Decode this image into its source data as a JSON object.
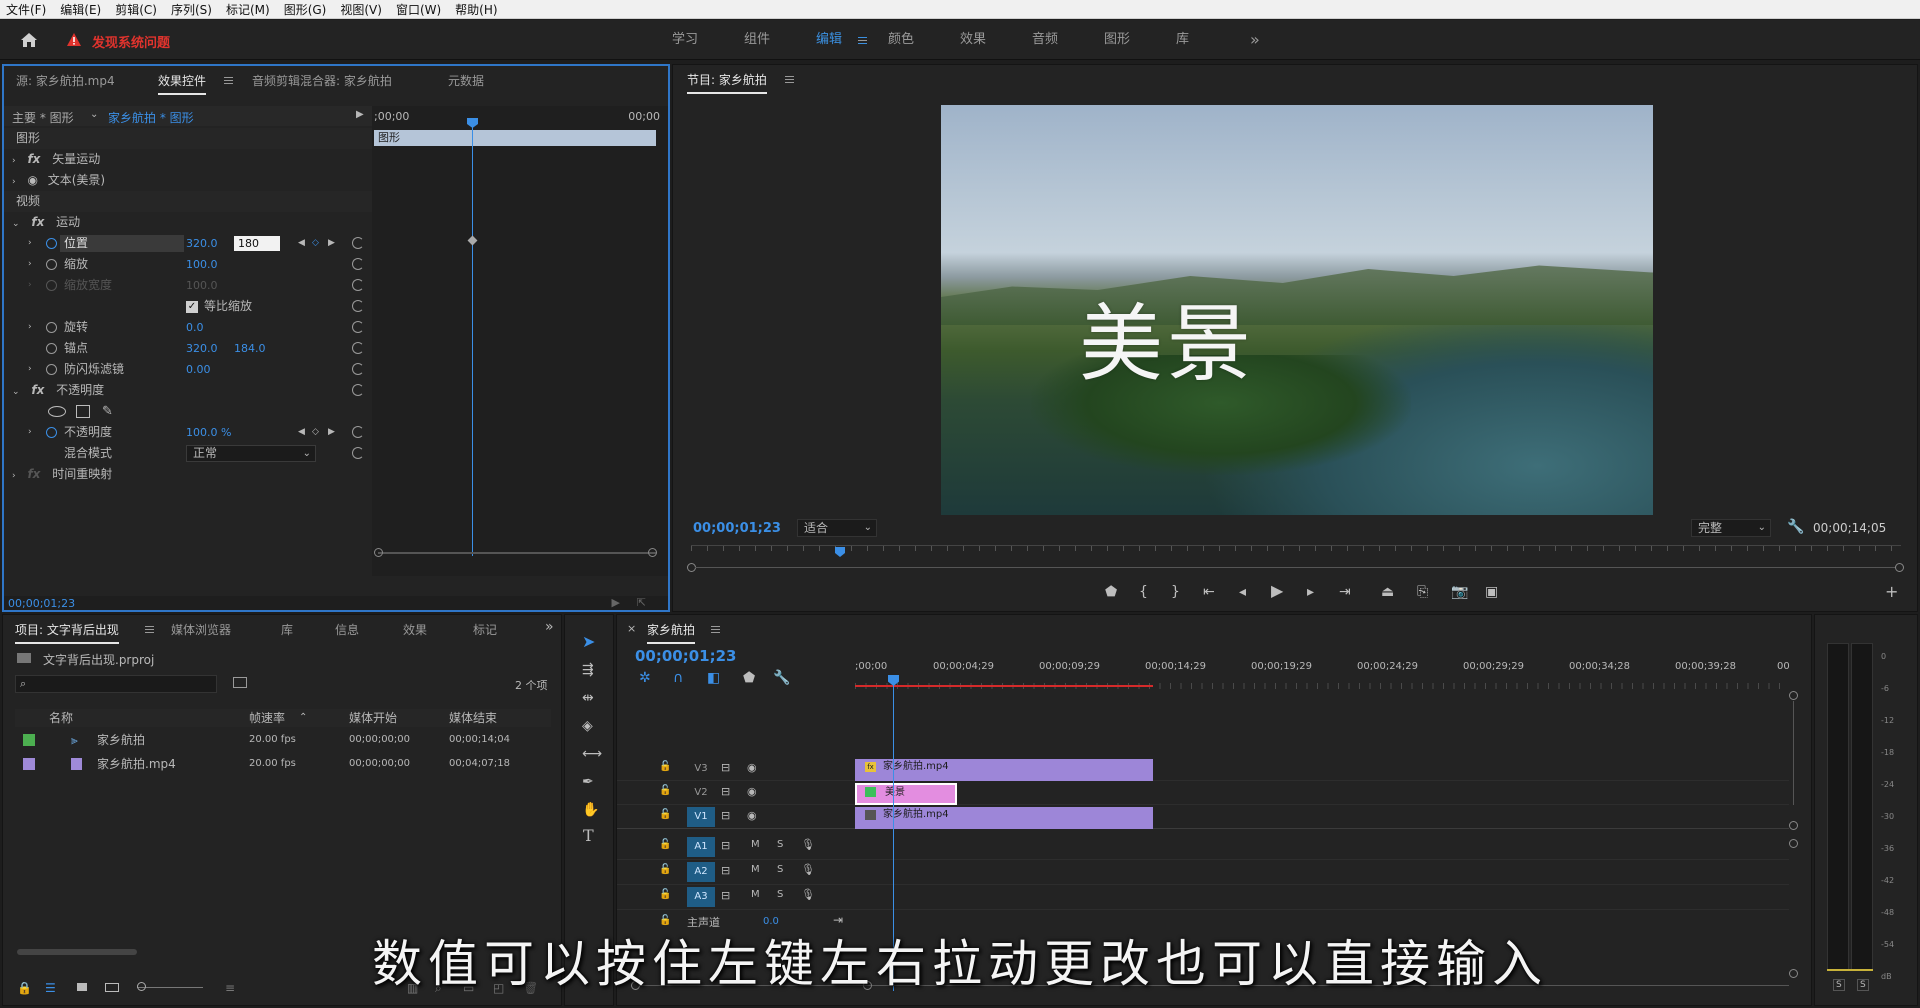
{
  "menu": [
    "文件(F)",
    "编辑(E)",
    "剪辑(C)",
    "序列(S)",
    "标记(M)",
    "图形(G)",
    "视图(V)",
    "窗口(W)",
    "帮助(H)"
  ],
  "alert": "发现系统问题",
  "workspaces": [
    "学习",
    "组件",
    "编辑",
    "颜色",
    "效果",
    "音频",
    "图形",
    "库"
  ],
  "active_workspace": "编辑",
  "left_panel": {
    "tabs": [
      "源: 家乡航拍.mp4",
      "效果控件",
      "音频剪辑混合器: 家乡航拍",
      "元数据"
    ],
    "master": "主要 * 图形",
    "clip": "家乡航拍 * 图形",
    "time_start": ";00;00",
    "time_end": "00;00",
    "clip_bar": "图形",
    "sec_graphics": "图形",
    "vector_motion": "矢量运动",
    "text_item": "文本(美景)",
    "sec_video": "视频",
    "motion": "运动",
    "position": "位置",
    "position_x": "320.0",
    "position_y": "180",
    "scale": "缩放",
    "scale_val": "100.0",
    "scale_width": "缩放宽度",
    "scale_width_val": "100.0",
    "uniform": "等比缩放",
    "rotation": "旋转",
    "rotation_val": "0.0",
    "anchor": "锚点",
    "anchor_x": "320.0",
    "anchor_y": "184.0",
    "flicker": "防闪烁滤镜",
    "flicker_val": "0.00",
    "opacity_group": "不透明度",
    "opacity": "不透明度",
    "opacity_val": "100.0 %",
    "blend": "混合模式",
    "blend_val": "正常",
    "time_remap": "时间重映射",
    "timecode": "00;00;01;23"
  },
  "program": {
    "title": "节目: 家乡航拍",
    "overlay_text": "美景",
    "timecode": "00;00;01;23",
    "fit": "适合",
    "quality": "完整",
    "duration": "00;00;14;05"
  },
  "project": {
    "tabs": [
      "项目: 文字背后出现",
      "媒体浏览器",
      "库",
      "信息",
      "效果",
      "标记"
    ],
    "file": "文字背后出现.prproj",
    "count": "2 个项",
    "columns": [
      "名称",
      "帧速率",
      "媒体开始",
      "媒体结束"
    ],
    "rows": [
      {
        "name": "家乡航拍",
        "fps": "20.00 fps",
        "start": "00;00;00;00",
        "end": "00;00;14;04",
        "color": "#4caf50"
      },
      {
        "name": "家乡航拍.mp4",
        "fps": "20.00 fps",
        "start": "00;00;00;00",
        "end": "00;04;07;18",
        "color": "#9f8ad8"
      }
    ]
  },
  "timeline": {
    "title": "家乡航拍",
    "timecode": "00;00;01;23",
    "ruler": [
      ";00;00",
      "00;00;04;29",
      "00;00;09;29",
      "00;00;14;29",
      "00;00;19;29",
      "00;00;24;29",
      "00;00;29;29",
      "00;00;34;28",
      "00;00;39;28",
      "00"
    ],
    "video_tracks": [
      "V3",
      "V2",
      "V1"
    ],
    "audio_tracks": [
      "A1",
      "A2",
      "A3"
    ],
    "master": "主声道",
    "master_val": "0.0",
    "clip_v3": "家乡航拍.mp4",
    "clip_v2": "美景",
    "clip_v1": "家乡航拍.mp4",
    "m": "M",
    "s": "S"
  },
  "meter": {
    "scale": [
      "0",
      "-6",
      "-12",
      "-18",
      "-24",
      "-30",
      "-36",
      "-42",
      "-48",
      "-54",
      "dB"
    ],
    "s_label": "S"
  },
  "subtitle": "数值可以按住左键左右拉动更改也可以直接输入",
  "colors": {
    "accent": "#3b8fe6",
    "clip": "#9d86d8",
    "graphic_clip": "#e38de0"
  }
}
